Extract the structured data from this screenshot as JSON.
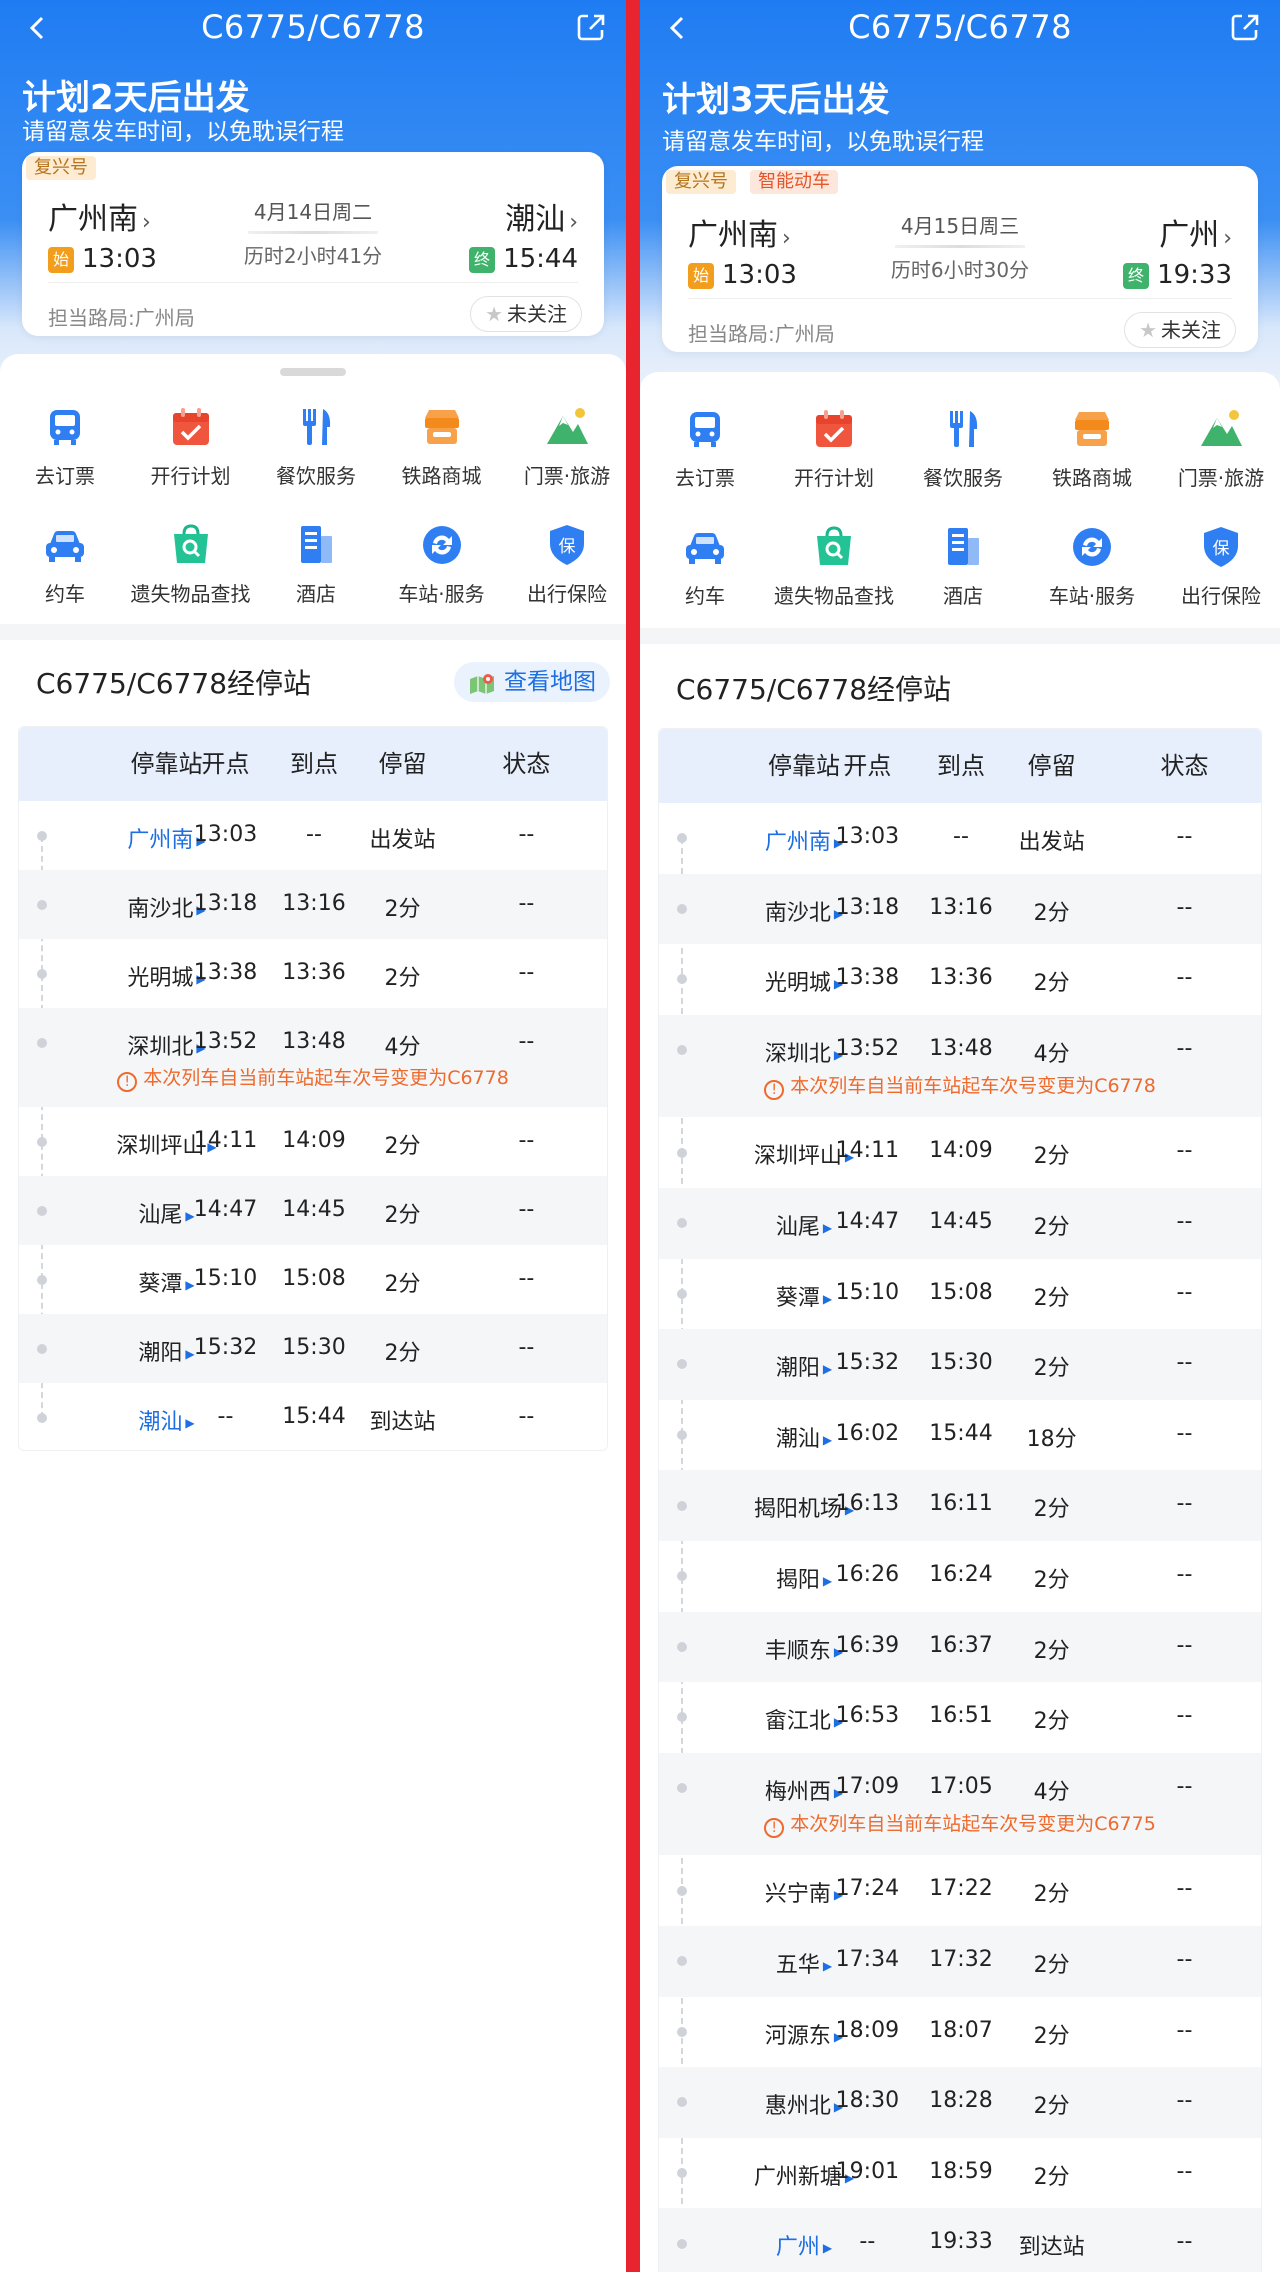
{
  "panels": [
    {
      "title": "C6775/C6778",
      "plan": "计划2天后出发",
      "tip": "请留意发车时间，以免耽误行程",
      "tags": [
        "复兴号"
      ],
      "from": {
        "station": "广州南",
        "badge": "始",
        "time": "13:03"
      },
      "to": {
        "station": "潮汕",
        "badge": "终",
        "time": "15:44"
      },
      "date": "4月14日周二",
      "duration": "历时2小时41分",
      "bureau": "担当路局:广州局",
      "follow": "未关注",
      "stops_title": "C6775/C6778经停站",
      "map_button": "查看地图"
    },
    {
      "title": "C6775/C6778",
      "plan": "计划3天后出发",
      "tip": "请留意发车时间，以免耽误行程",
      "tags": [
        "复兴号",
        "智能动车"
      ],
      "from": {
        "station": "广州南",
        "badge": "始",
        "time": "13:03"
      },
      "to": {
        "station": "广州",
        "badge": "终",
        "time": "19:33"
      },
      "date": "4月15日周三",
      "duration": "历时6小时30分",
      "bureau": "担当路局:广州局",
      "follow": "未关注",
      "stops_title": "C6775/C6778经停站"
    }
  ],
  "services": [
    "去订票",
    "开行计划",
    "餐饮服务",
    "铁路商城",
    "门票·旅游",
    "约车",
    "遗失物品查找",
    "酒店",
    "车站·服务",
    "出行保险"
  ],
  "table_headers": [
    "停靠站",
    "开点",
    "到点",
    "停留",
    "状态"
  ],
  "left_stops": [
    {
      "station": "广州南",
      "dep": "13:03",
      "arr": "--",
      "stay": "出发站",
      "status": "--",
      "hl": true
    },
    {
      "station": "南沙北",
      "dep": "13:18",
      "arr": "13:16",
      "stay": "2分",
      "status": "--"
    },
    {
      "station": "光明城",
      "dep": "13:38",
      "arr": "13:36",
      "stay": "2分",
      "status": "--"
    },
    {
      "station": "深圳北",
      "dep": "13:52",
      "arr": "13:48",
      "stay": "4分",
      "status": "--",
      "note": "本次列车自当前车站起车次号变更为C6778"
    },
    {
      "station": "深圳坪山",
      "dep": "14:11",
      "arr": "14:09",
      "stay": "2分",
      "status": "--"
    },
    {
      "station": "汕尾",
      "dep": "14:47",
      "arr": "14:45",
      "stay": "2分",
      "status": "--"
    },
    {
      "station": "葵潭",
      "dep": "15:10",
      "arr": "15:08",
      "stay": "2分",
      "status": "--"
    },
    {
      "station": "潮阳",
      "dep": "15:32",
      "arr": "15:30",
      "stay": "2分",
      "status": "--"
    },
    {
      "station": "潮汕",
      "dep": "--",
      "arr": "15:44",
      "stay": "到达站",
      "status": "--",
      "hl": true
    }
  ],
  "right_stops": [
    {
      "station": "广州南",
      "dep": "13:03",
      "arr": "--",
      "stay": "出发站",
      "status": "--",
      "hl": true
    },
    {
      "station": "南沙北",
      "dep": "13:18",
      "arr": "13:16",
      "stay": "2分",
      "status": "--"
    },
    {
      "station": "光明城",
      "dep": "13:38",
      "arr": "13:36",
      "stay": "2分",
      "status": "--"
    },
    {
      "station": "深圳北",
      "dep": "13:52",
      "arr": "13:48",
      "stay": "4分",
      "status": "--",
      "note": "本次列车自当前车站起车次号变更为C6778"
    },
    {
      "station": "深圳坪山",
      "dep": "14:11",
      "arr": "14:09",
      "stay": "2分",
      "status": "--"
    },
    {
      "station": "汕尾",
      "dep": "14:47",
      "arr": "14:45",
      "stay": "2分",
      "status": "--"
    },
    {
      "station": "葵潭",
      "dep": "15:10",
      "arr": "15:08",
      "stay": "2分",
      "status": "--"
    },
    {
      "station": "潮阳",
      "dep": "15:32",
      "arr": "15:30",
      "stay": "2分",
      "status": "--"
    },
    {
      "station": "潮汕",
      "dep": "16:02",
      "arr": "15:44",
      "stay": "18分",
      "status": "--"
    },
    {
      "station": "揭阳机场",
      "dep": "16:13",
      "arr": "16:11",
      "stay": "2分",
      "status": "--"
    },
    {
      "station": "揭阳",
      "dep": "16:26",
      "arr": "16:24",
      "stay": "2分",
      "status": "--"
    },
    {
      "station": "丰顺东",
      "dep": "16:39",
      "arr": "16:37",
      "stay": "2分",
      "status": "--"
    },
    {
      "station": "畲江北",
      "dep": "16:53",
      "arr": "16:51",
      "stay": "2分",
      "status": "--"
    },
    {
      "station": "梅州西",
      "dep": "17:09",
      "arr": "17:05",
      "stay": "4分",
      "status": "--",
      "note": "本次列车自当前车站起车次号变更为C6775"
    },
    {
      "station": "兴宁南",
      "dep": "17:24",
      "arr": "17:22",
      "stay": "2分",
      "status": "--"
    },
    {
      "station": "五华",
      "dep": "17:34",
      "arr": "17:32",
      "stay": "2分",
      "status": "--"
    },
    {
      "station": "河源东",
      "dep": "18:09",
      "arr": "18:07",
      "stay": "2分",
      "status": "--"
    },
    {
      "station": "惠州北",
      "dep": "18:30",
      "arr": "18:28",
      "stay": "2分",
      "status": "--"
    },
    {
      "station": "广州新塘",
      "dep": "19:01",
      "arr": "18:59",
      "stay": "2分",
      "status": "--"
    },
    {
      "station": "广州",
      "dep": "--",
      "arr": "19:33",
      "stay": "到达站",
      "status": "--",
      "hl": true
    }
  ],
  "colors": {
    "primary": "#1f7cf2",
    "accent_blue": "#1d6fe3",
    "warning": "#ee6a2d",
    "divider": "#e8242f",
    "start_badge": "#f29d1b",
    "end_badge": "#3fb26c"
  },
  "icons": [
    "back-icon",
    "share-icon",
    "ticket-icon",
    "plan-icon",
    "dining-icon",
    "mall-icon",
    "tour-icon",
    "car-icon",
    "lost-found-icon",
    "hotel-icon",
    "station-service-icon",
    "insurance-icon",
    "map-icon",
    "star-icon",
    "triangle-right-icon",
    "warning-icon"
  ]
}
